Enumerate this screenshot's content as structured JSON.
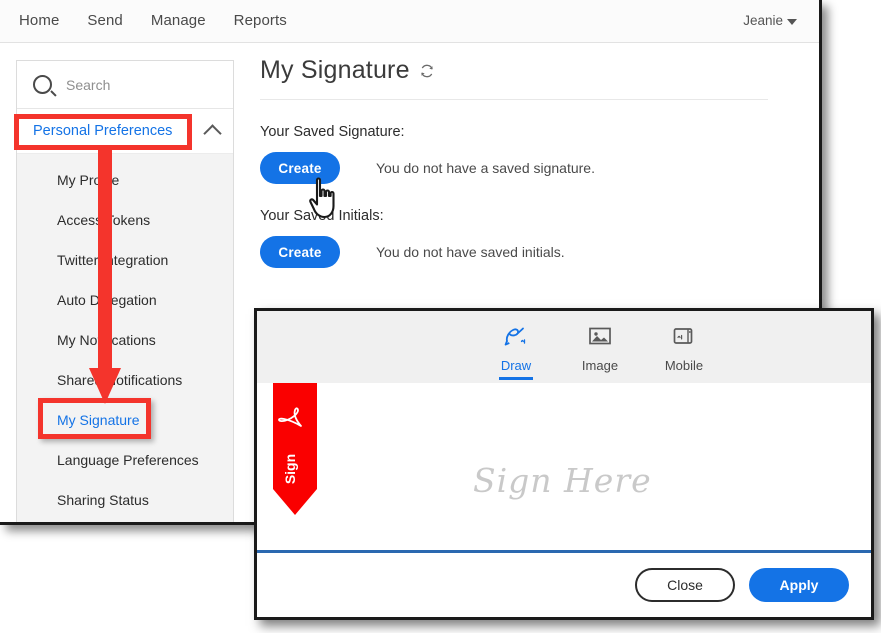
{
  "topnav": {
    "links": [
      {
        "label": "Home"
      },
      {
        "label": "Send"
      },
      {
        "label": "Manage"
      },
      {
        "label": "Reports"
      }
    ],
    "user": {
      "name": "Jeanie",
      "caret_icon": "chevron-down-icon"
    }
  },
  "sidebar": {
    "search": {
      "placeholder": "Search",
      "value": "",
      "icon": "search-icon"
    },
    "group": {
      "title": "Personal Preferences",
      "collapse_icon": "chevron-up-icon",
      "items": [
        {
          "label": "My Profile",
          "active": false
        },
        {
          "label": "Access Tokens",
          "active": false
        },
        {
          "label": "Twitter Integration",
          "active": false
        },
        {
          "label": "Auto Delegation",
          "active": false
        },
        {
          "label": "My Notifications",
          "active": false
        },
        {
          "label": "Shared Notifications",
          "active": false
        },
        {
          "label": "My Signature",
          "active": true
        },
        {
          "label": "Language Preferences",
          "active": false
        },
        {
          "label": "Sharing Status",
          "active": false
        }
      ]
    }
  },
  "main": {
    "title": "My Signature",
    "refresh_icon": "refresh-icon",
    "signature_section": {
      "label": "Your Saved Signature:",
      "button": "Create",
      "status": "You do not have a saved signature."
    },
    "initials_section": {
      "label": "Your Saved Initials:",
      "button": "Create",
      "status": "You do not have saved initials."
    }
  },
  "dialog": {
    "tabs": [
      {
        "label": "Draw",
        "icon": "pen-draw-icon",
        "active": true
      },
      {
        "label": "Image",
        "icon": "image-icon",
        "active": false
      },
      {
        "label": "Mobile",
        "icon": "mobile-device-icon",
        "active": false
      }
    ],
    "canvas": {
      "flag_label": "Sign",
      "flag_icon": "adobe-acrobat-icon",
      "placeholder": "Sign Here"
    },
    "footer": {
      "close_label": "Close",
      "apply_label": "Apply"
    }
  },
  "annotations": {
    "highlight_color": "#f4342c",
    "boxes": [
      {
        "target": "Personal Preferences"
      },
      {
        "target": "My Signature"
      }
    ],
    "arrow": {
      "from": "Personal Preferences",
      "to": "My Signature"
    }
  },
  "colors": {
    "accent_blue": "#1473e6",
    "annotation_red": "#f4342c",
    "signature_line": "#2a68b0",
    "adobe_red": "#fa0000"
  }
}
